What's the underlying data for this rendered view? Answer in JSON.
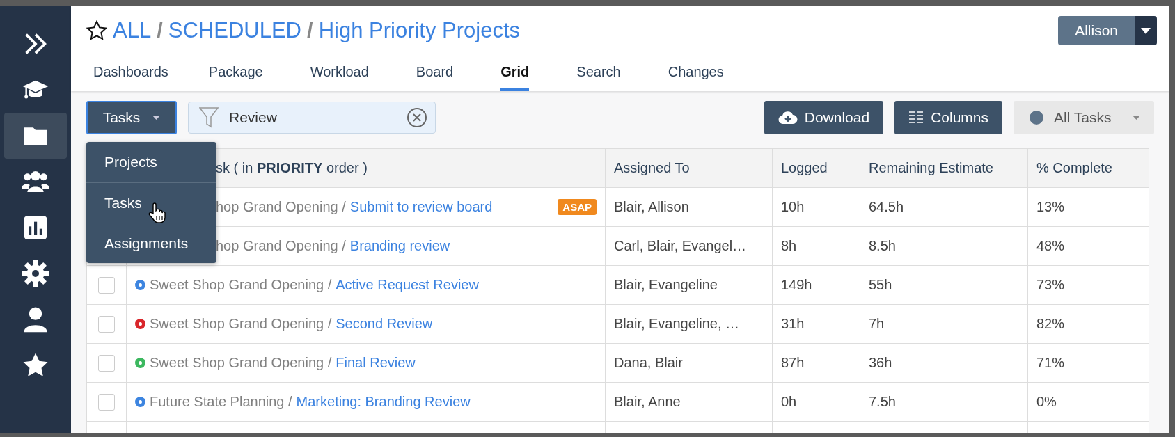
{
  "sidebar": {
    "items": [
      {
        "kind": "expand",
        "selected": false
      },
      {
        "kind": "learn",
        "selected": false
      },
      {
        "kind": "projects",
        "selected": true
      },
      {
        "kind": "people",
        "selected": false
      },
      {
        "kind": "reports",
        "selected": false
      },
      {
        "kind": "settings",
        "selected": false
      },
      {
        "kind": "profile",
        "selected": false
      },
      {
        "kind": "favorites",
        "selected": false
      }
    ]
  },
  "header": {
    "starred": false,
    "breadcrumbs": [
      "ALL",
      "SCHEDULED",
      "High Priority Projects"
    ],
    "separator": "/",
    "user": "Allison"
  },
  "tabs": [
    {
      "label": "Dashboards",
      "selected": false
    },
    {
      "label": "Package",
      "selected": false
    },
    {
      "label": "Workload",
      "selected": false
    },
    {
      "label": "Board",
      "selected": false
    },
    {
      "label": "Grid",
      "selected": true
    },
    {
      "label": "Search",
      "selected": false
    },
    {
      "label": "Changes",
      "selected": false
    }
  ],
  "toolbar": {
    "type_button": "Tasks",
    "filter": {
      "value": "Review"
    },
    "download": "Download",
    "columns": "Columns",
    "status_filter": "All Tasks"
  },
  "type_menu": {
    "items": [
      {
        "label": "Projects",
        "hovered": false
      },
      {
        "label": "Tasks",
        "hovered": true
      },
      {
        "label": "Assignments",
        "hovered": false
      }
    ]
  },
  "table": {
    "columns": [
      "sk  ( in **PRIORITY** order )",
      "Assigned To",
      "Logged",
      "Remaining Estimate",
      "% Complete"
    ],
    "rows": [
      {
        "project": "hop Grand Opening /",
        "task": "Submit to review board",
        "badge": "ASAP",
        "assigned": "Blair, Allison",
        "logged": "10h",
        "remaining": "64.5h",
        "complete": "13%"
      },
      {
        "project": "hop Grand Opening /",
        "task": "Branding review",
        "assigned": "Carl, Blair, Evangel…",
        "logged": "8h",
        "remaining": "8.5h",
        "complete": "48%"
      },
      {
        "checked": false,
        "color": "#3d85e0",
        "project": "Sweet Shop Grand Opening /",
        "task": "Active Request Review",
        "assigned": "Blair, Evangeline",
        "logged": "149h",
        "remaining": "55h",
        "complete": "73%"
      },
      {
        "checked": false,
        "color": "#d9262b",
        "project": "Sweet Shop Grand Opening /",
        "task": "Second Review",
        "assigned": "Blair, Evangeline, …",
        "logged": "31h",
        "remaining": "7h",
        "complete": "82%"
      },
      {
        "checked": false,
        "color": "#3cb85f",
        "project": "Sweet Shop Grand Opening /",
        "task": "Final Review",
        "assigned": "Dana, Blair",
        "logged": "87h",
        "remaining": "36h",
        "complete": "71%"
      },
      {
        "checked": false,
        "color": "#3d85e0",
        "project": "Future State Planning /",
        "task": "Marketing: Branding Review",
        "assigned": "Blair, Anne",
        "logged": "0h",
        "remaining": "7.5h",
        "complete": "0%"
      }
    ]
  }
}
